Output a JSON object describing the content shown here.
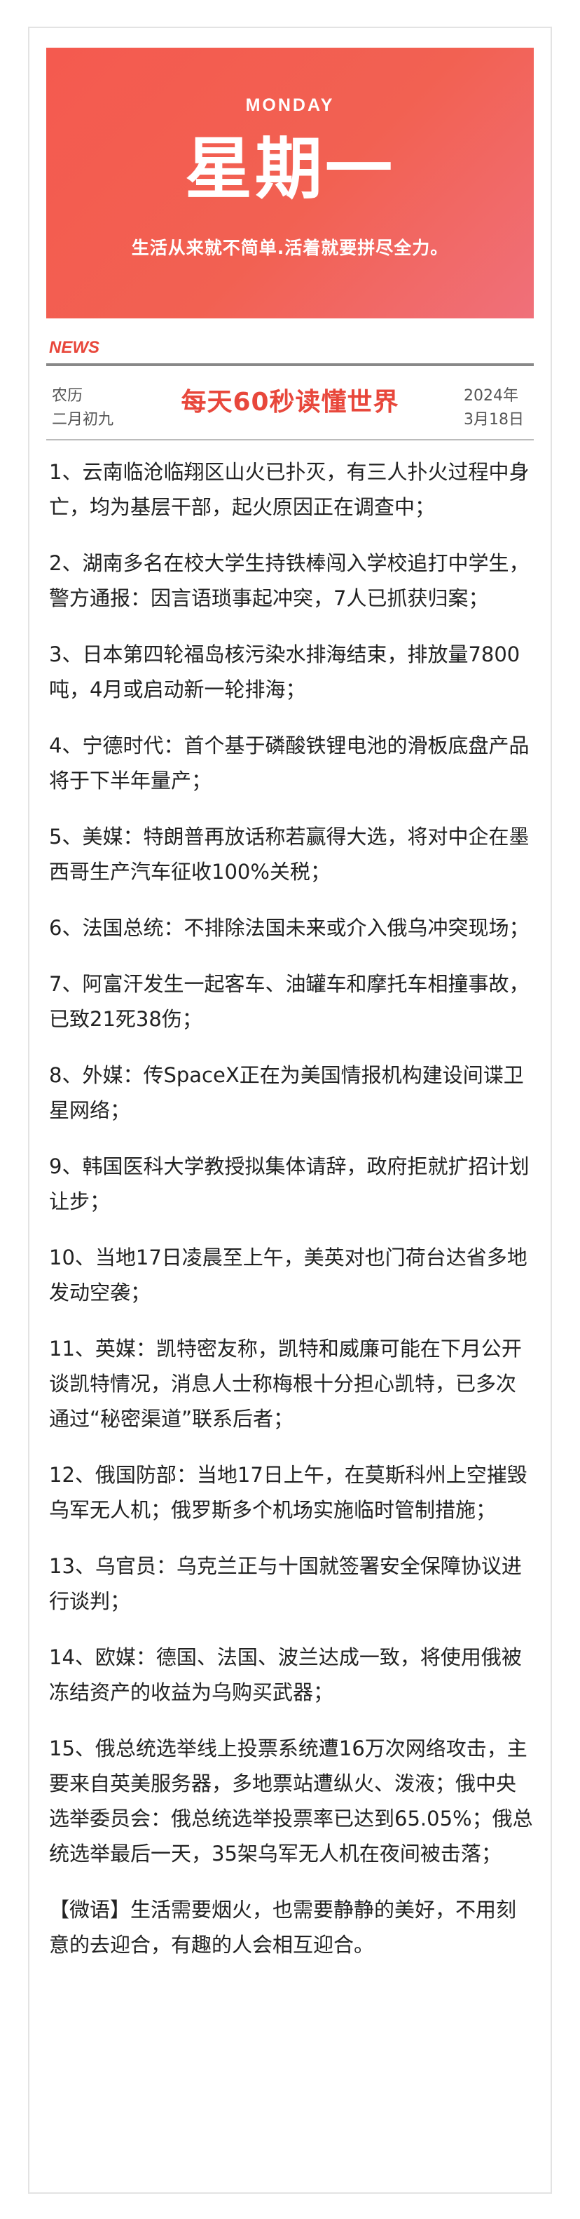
{
  "banner": {
    "weekday_en": "MONDAY",
    "weekday_cn": "星期一",
    "motto": "生活从来就不简单.活着就要拼尽全力。"
  },
  "header": {
    "news_label": "NEWS",
    "lunar_label": "农历",
    "lunar_date": "二月初九",
    "title": "每天60秒读懂世界",
    "year": "2024年",
    "month_day": "3月18日"
  },
  "items": [
    "1、云南临沧临翔区山火已扑灭，有三人扑火过程中身亡，均为基层干部，起火原因正在调查中；",
    "2、湖南多名在校大学生持铁棒闯入学校追打中学生，警方通报：因言语琐事起冲突，7人已抓获归案；",
    "3、日本第四轮福岛核污染水排海结束，排放量7800吨，4月或启动新一轮排海；",
    "4、宁德时代：首个基于磷酸铁锂电池的滑板底盘产品将于下半年量产；",
    "5、美媒：特朗普再放话称若赢得大选，将对中企在墨西哥生产汽车征收100%关税；",
    "6、法国总统：不排除法国未来或介入俄乌冲突现场；",
    "7、阿富汗发生一起客车、油罐车和摩托车相撞事故，已致21死38伤；",
    "8、外媒：传SpaceX正在为美国情报机构建设间谍卫星网络；",
    "9、韩国医科大学教授拟集体请辞，政府拒就扩招计划让步；",
    "10、当地17日凌晨至上午，美英对也门荷台达省多地发动空袭；",
    "11、英媒：凯特密友称，凯特和威廉可能在下月公开谈凯特情况，消息人士称梅根十分担心凯特，已多次通过“秘密渠道”联系后者；",
    "12、俄国防部：当地17日上午，在莫斯科州上空摧毁乌军无人机；俄罗斯多个机场实施临时管制措施；",
    "13、乌官员：乌克兰正与十国就签署安全保障协议进行谈判；",
    "14、欧媒：德国、法国、波兰达成一致，将使用俄被冻结资产的收益为乌购买武器；",
    "15、俄总统选举线上投票系统遭16万次网络攻击，主要来自英美服务器，多地票站遭纵火、泼液；俄中央选举委员会：俄总统选举投票率已达到65.05%；俄总统选举最后一天，35架乌军无人机在夜间被击落；"
  ],
  "quote": "【微语】生活需要烟火，也需要静静的美好，不用刻意的去迎合，有趣的人会相互迎合。",
  "colors": {
    "accent": "#e8473b",
    "banner_gradient_start": "#f45a4f",
    "banner_gradient_end": "#f0707a"
  }
}
